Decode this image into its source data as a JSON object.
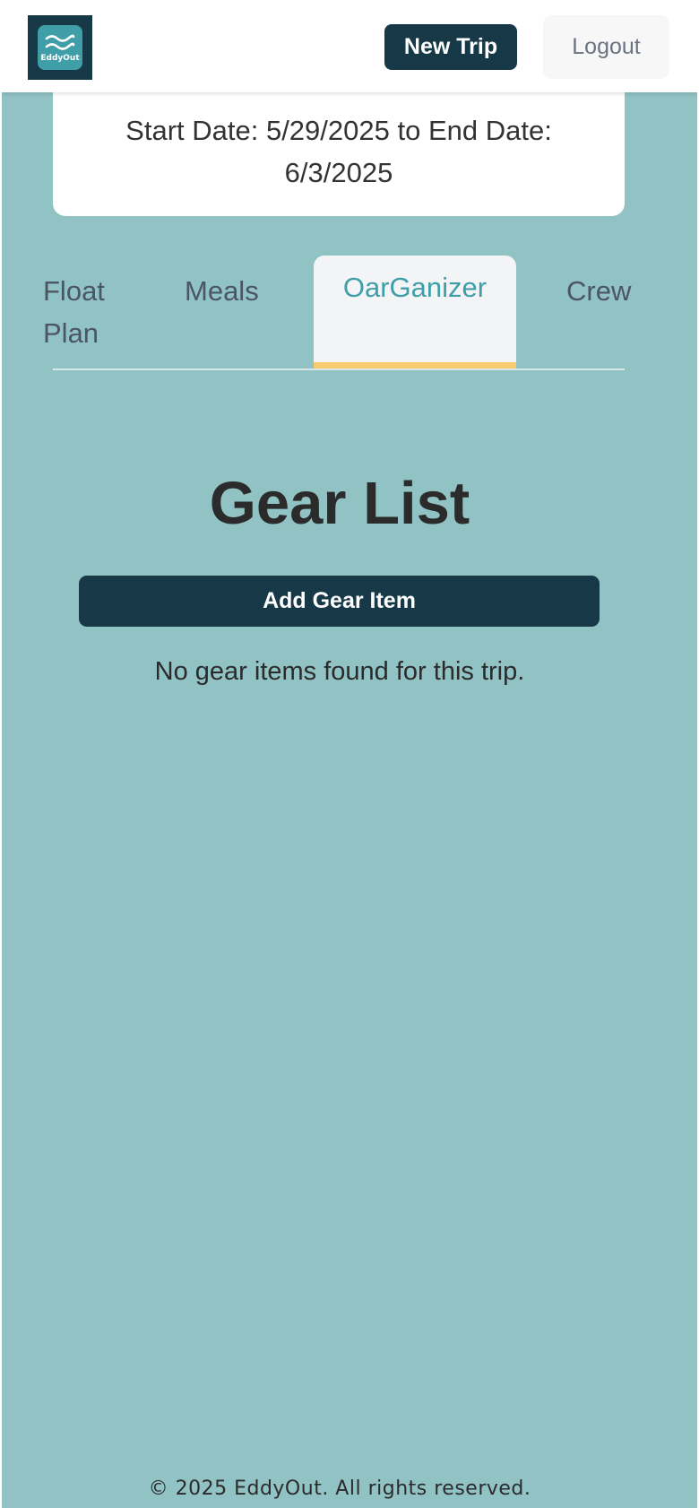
{
  "header": {
    "logo_text": "EddyOut",
    "new_trip_label": "New Trip",
    "logout_label": "Logout"
  },
  "trip": {
    "date_range": "Start Date: 5/29/2025 to End Date: 6/3/2025"
  },
  "tabs": [
    {
      "label": "Float Plan",
      "active": false
    },
    {
      "label": "Meals",
      "active": false
    },
    {
      "label": "OarGanizer",
      "active": true
    },
    {
      "label": "Crew",
      "active": false
    }
  ],
  "gear": {
    "title": "Gear List",
    "add_label": "Add Gear Item",
    "empty_message": "No gear items found for this trip."
  },
  "footer": {
    "copyright": "© 2025 EddyOut. All rights reserved."
  },
  "colors": {
    "background": "#91c2c4",
    "primary": "#173847",
    "accent": "#3f9ea8",
    "tab_underline": "#f6cc6e"
  },
  "icons": {
    "logo": "waves-icon"
  }
}
